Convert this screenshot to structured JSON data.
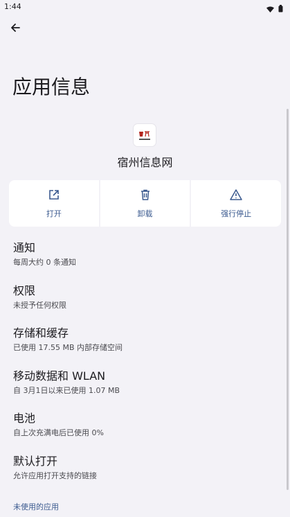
{
  "status": {
    "time": "1:44"
  },
  "page": {
    "title": "应用信息"
  },
  "app": {
    "name": "宿州信息网",
    "icon_text": "宿州"
  },
  "actions": [
    {
      "label": "打开",
      "icon": "open-external-icon"
    },
    {
      "label": "卸载",
      "icon": "trash-icon"
    },
    {
      "label": "强行停止",
      "icon": "warning-icon"
    }
  ],
  "settings": [
    {
      "title": "通知",
      "subtitle": "每周大约 0 条通知"
    },
    {
      "title": "权限",
      "subtitle": "未授予任何权限"
    },
    {
      "title": "存储和缓存",
      "subtitle": "已使用 17.55 MB 内部存储空间"
    },
    {
      "title": "移动数据和 WLAN",
      "subtitle": "自 3月1日以来已使用 1.07 MB"
    },
    {
      "title": "电池",
      "subtitle": "自上次充满电后已使用 0%"
    },
    {
      "title": "默认打开",
      "subtitle": "允许应用打开支持的链接"
    }
  ],
  "unused_apps": {
    "label": "未使用的应用"
  },
  "colors": {
    "background": "#f3f2f7",
    "accent": "#3b5a8f",
    "card": "#ffffff"
  }
}
